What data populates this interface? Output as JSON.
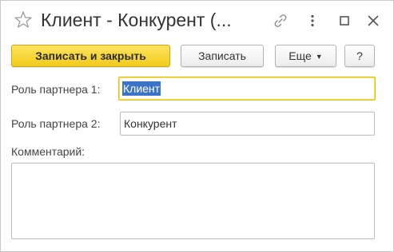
{
  "window": {
    "title": "Клиент - Конкурент (..."
  },
  "toolbar": {
    "save_close_label": "Записать и закрыть",
    "save_label": "Записать",
    "more_label": "Еще",
    "help_label": "?"
  },
  "form": {
    "partner_role_1": {
      "label": "Роль партнера 1:",
      "value": "Клиент"
    },
    "partner_role_2": {
      "label": "Роль партнера 2:",
      "value": "Конкурент"
    },
    "comment": {
      "label": "Комментарий:",
      "value": ""
    }
  },
  "colors": {
    "primary_button": "#f2cb1a",
    "selection": "#3b73c9",
    "focus_border": "#e6c200"
  }
}
